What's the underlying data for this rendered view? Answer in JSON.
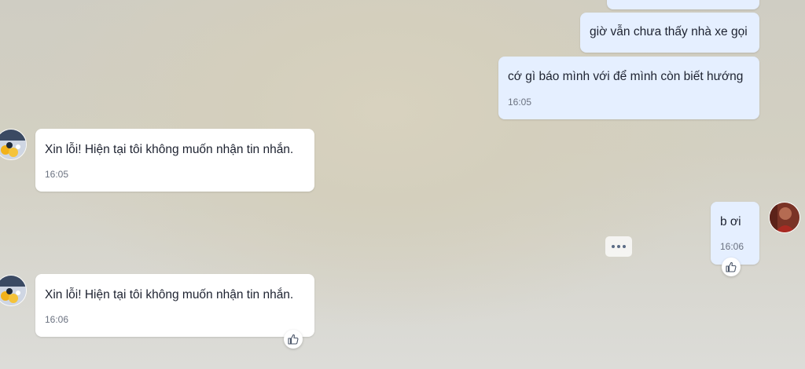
{
  "messages": [
    {
      "text": "giờ vẫn chưa thấy nhà xe gọi",
      "direction": "outgoing"
    },
    {
      "text": "cớ gì báo mình với để mình còn biết hướng",
      "time": "16:05",
      "direction": "outgoing"
    },
    {
      "text": "Xin lỗi! Hiện tại tôi không muốn nhận tin nhắn.",
      "time": "16:05",
      "direction": "incoming"
    },
    {
      "text": "b ơi",
      "time": "16:06",
      "direction": "outgoing"
    },
    {
      "text": "Xin lỗi! Hiện tại tôi không muốn nhận tin nhắn.",
      "time": "16:06",
      "direction": "incoming"
    }
  ],
  "icons": {
    "like": "thumbs-up-icon",
    "more": "more-options-icon"
  },
  "colors": {
    "outgoing_bubble": "#e5efff",
    "incoming_bubble": "#ffffff",
    "text": "#1d2230",
    "time": "#6b7280"
  }
}
